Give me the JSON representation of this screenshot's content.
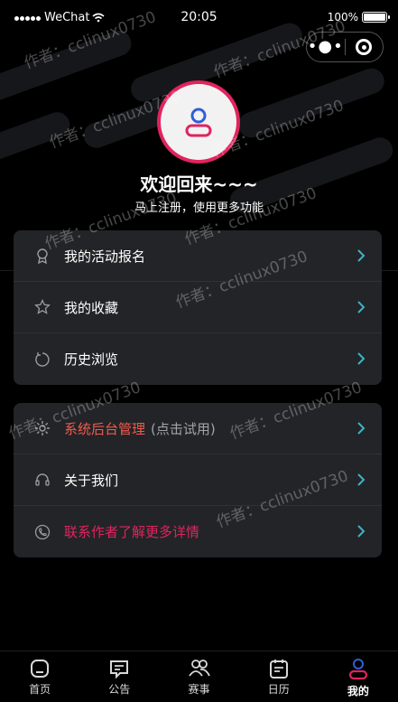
{
  "status_bar": {
    "carrier": "WeChat",
    "time": "20:05",
    "battery": "100%"
  },
  "capsule": {
    "more_icon": "more-dots-icon",
    "close_icon": "target-circle-icon"
  },
  "profile": {
    "avatar_icon": "user-icon",
    "welcome": "欢迎回来~~~",
    "subtitle": "马上注册，使用更多功能"
  },
  "menu_group_1": [
    {
      "label": "我的活动报名",
      "icon": "badge-icon"
    },
    {
      "label": "我的收藏",
      "icon": "star-icon"
    },
    {
      "label": "历史浏览",
      "icon": "history-icon"
    }
  ],
  "menu_group_2": [
    {
      "label": "系统后台管理",
      "note": "(点击试用)",
      "icon": "gear-icon",
      "color": "#ef5b4d"
    },
    {
      "label": "关于我们",
      "icon": "headset-icon"
    },
    {
      "label": "联系作者了解更多详情",
      "icon": "phone-icon",
      "color": "#e0245e"
    }
  ],
  "watermark": "作者：cclinux0730",
  "tabs": [
    {
      "label": "首页",
      "icon": "home-icon"
    },
    {
      "label": "公告",
      "icon": "message-icon"
    },
    {
      "label": "赛事",
      "icon": "users-icon"
    },
    {
      "label": "日历",
      "icon": "calendar-icon"
    },
    {
      "label": "我的",
      "icon": "user-icon",
      "active": true
    }
  ],
  "colors": {
    "accent_pink": "#e0245e",
    "accent_red": "#ef5b4d",
    "chevron_teal": "#3db3c6",
    "card_bg": "#232427"
  }
}
